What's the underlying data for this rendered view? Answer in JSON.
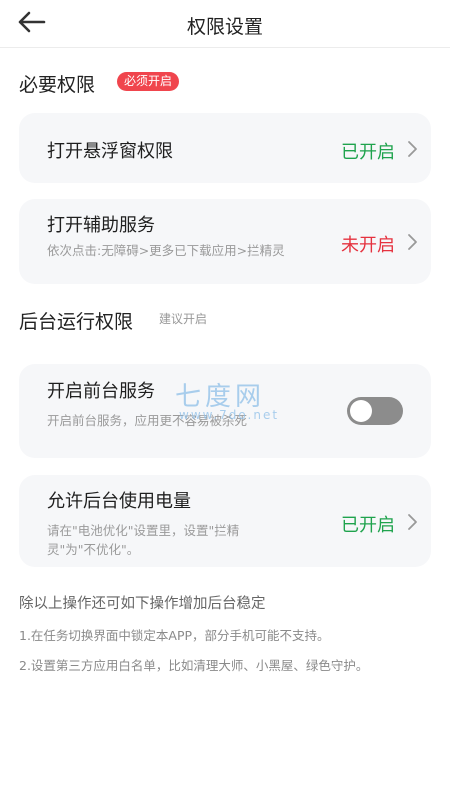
{
  "header": {
    "title": "权限设置",
    "back_icon": "arrow-left-icon"
  },
  "section_required": {
    "title": "必要权限",
    "badge": "必须开启"
  },
  "floating_window": {
    "title": "打开悬浮窗权限",
    "status": "已开启"
  },
  "accessibility": {
    "title": "打开辅助服务",
    "desc": "依次点击:无障碍>更多已下载应用>拦精灵",
    "status": "未开启"
  },
  "section_background": {
    "title": "后台运行权限",
    "hint": "建议开启"
  },
  "foreground_service": {
    "title": "开启前台服务",
    "desc": "开启前台服务，应用更不容易被杀死",
    "toggle_on": false
  },
  "battery": {
    "title": "允许后台使用电量",
    "desc": "请在\"电池优化\"设置里，设置\"拦精灵\"为\"不优化\"。",
    "status": "已开启"
  },
  "footer": {
    "title": "除以上操作还可如下操作增加后台稳定",
    "lines": [
      "1.在任务切换界面中锁定本APP，部分手机可能不支持。",
      "2.设置第三方应用白名单，比如清理大师、小黑屋、绿色守护。"
    ]
  },
  "watermark": {
    "big": "七度网",
    "small": "www.7do.net"
  },
  "colors": {
    "on": "#1fa34d",
    "off": "#e5323f",
    "badge": "#f0454d"
  }
}
